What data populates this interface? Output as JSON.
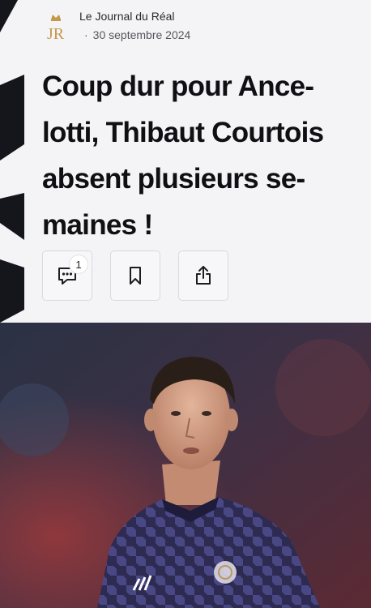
{
  "source": {
    "name": "Le Journal du Réal",
    "dot": "·",
    "date": "30 septembre 2024",
    "logo_text": "JR",
    "logo_icon": "crown-logo-icon"
  },
  "article": {
    "title_lines": [
      "Coup dur pour Ance-",
      "lotti, Thibaut Courtois",
      "absent plusieurs se-",
      "maines !"
    ]
  },
  "actions": {
    "comments_count": "1",
    "comment_icon": "comment-icon",
    "bookmark_icon": "bookmark-icon",
    "share_icon": "share-icon"
  },
  "colors": {
    "background": "#f4f4f7",
    "title": "#0f0f14",
    "logo_gold": "#c49a4a",
    "stripe": "#15151c",
    "jersey": "#2e2b52"
  }
}
